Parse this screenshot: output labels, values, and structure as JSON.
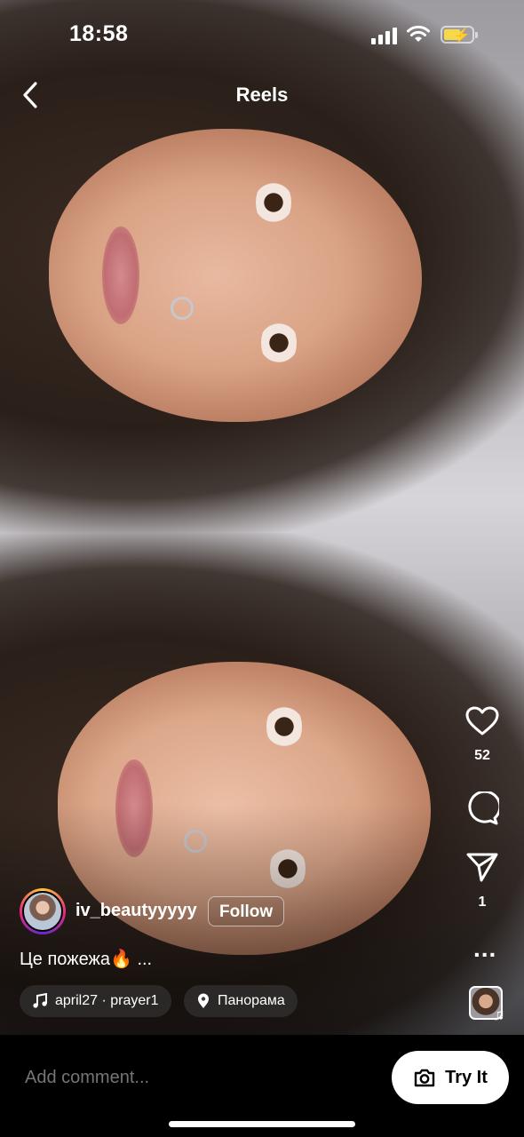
{
  "status_bar": {
    "time": "18:58"
  },
  "header": {
    "title": "Reels"
  },
  "actions": {
    "likes": "52",
    "shares": "1",
    "more": "..."
  },
  "author": {
    "username": "iv_beautyyyyy",
    "follow_label": "Follow"
  },
  "caption": "Це пожежа🔥 ...",
  "audio": {
    "label": "april27 · prayer1"
  },
  "location": {
    "label": "Панорама"
  },
  "comment_bar": {
    "placeholder": "Add comment...",
    "try_label": "Try It"
  },
  "icons": [
    "back-icon",
    "heart-icon",
    "comment-icon",
    "send-icon",
    "more-icon",
    "music-icon",
    "location-pin-icon",
    "camera-icon",
    "signal-icon",
    "wifi-icon",
    "battery-icon"
  ]
}
